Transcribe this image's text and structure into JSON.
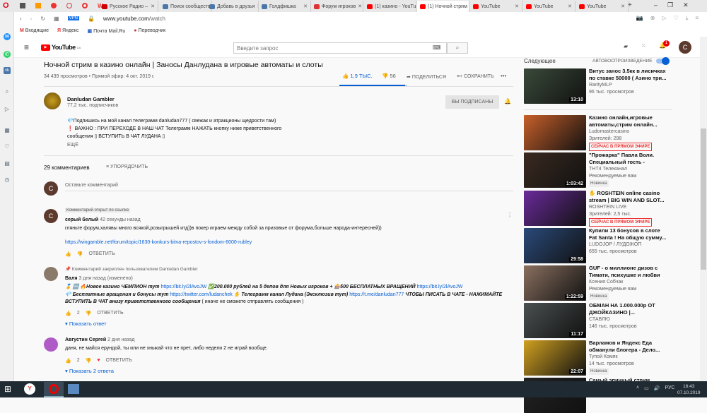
{
  "browser": {
    "tabs": [
      {
        "label": "Русское Радио –",
        "color": "#c00"
      },
      {
        "label": "Поиск сообществ",
        "color": "#4a76a8"
      },
      {
        "label": "Добавь в друзья",
        "color": "#4a76a8"
      },
      {
        "label": "Голдфишка",
        "color": "#4a76a8"
      },
      {
        "label": "Форум игроков",
        "color": "#d33"
      },
      {
        "label": "(1) казино - YouTube",
        "color": "#f00"
      },
      {
        "label": "(1) Ночной стрим",
        "color": "#f00"
      },
      {
        "label": "YouTube",
        "color": "#f00"
      },
      {
        "label": "YouTube",
        "color": "#f00"
      },
      {
        "label": "YouTube",
        "color": "#f00"
      }
    ],
    "url_domain": "www.youtube.com",
    "url_path": "/watch",
    "vpn": "VPN",
    "bookmarks": [
      "Входящие",
      "Яндекс",
      "Почта Mail.Ru",
      "Переводчик"
    ]
  },
  "youtube": {
    "logo": "YouTube",
    "region": "UA",
    "search_placeholder": "Введите запрос",
    "notif_count": "1",
    "user_initial": "C",
    "video": {
      "title": "Ночной стрим в казино онлайн | Заносы Данлудана в игровые автоматы и слоты",
      "meta": "34 439 просмотров • Прямой эфир: 4 окт. 2019 г.",
      "likes": "1,9 ТЫС.",
      "dislikes": "56",
      "share": "ПОДЕЛИТЬСЯ",
      "save": "СОХРАНИТЬ",
      "like_ratio": 0.97
    },
    "channel": {
      "name": "Danludan Gambler",
      "subs": "77,2 тыс. подписчиков",
      "subscribed": "ВЫ ПОДПИСАНЫ",
      "desc": [
        "💎Подпишись на мой канал телеграмм  danludan777  ( свежак и атракционы щедрости там)",
        "❗ ВАЖНО  : ПРИ ПЕРЕХОДЕ В НАШ ЧАТ Телеграмм НАЖАТЬ кнопку ниже приветственного",
        "сообщения  ▯ ВСТУПИТЬ В ЧАТ ЛУДАНА ▯"
      ],
      "more": "ЕЩЁ"
    },
    "comments_count": "29 комментариев",
    "sort": "УПОРЯДОЧИТЬ",
    "add_comment": "Оставьте комментарий",
    "reply": "ОТВЕТИТЬ",
    "comments": [
      {
        "badge": "Комментарий открыт по ссылке",
        "author": "серый белый",
        "time": "42 секунды назад",
        "text": "гляньте форум,халявы много всякой,розыгрышей итд))в покер играем между собой за призовые от форума,больше народа-интересней))",
        "link": "https://wingamble.net/forum/topic/1630-konkurs-bitva-repostov-s-fondom-6000-rubley",
        "initial": "С"
      },
      {
        "pinned": "Комментарий закреплен пользователем Danludan Gambler",
        "author": "Валя",
        "time": "3 дня назад (изменено)",
        "l1a": "🏅 🆓 🔥Новое казино ЧЕМПИОН тут",
        "l1b": "https://bit.ly/2lAvoJW",
        "l1c": "✅200.000 рублей на 5 депов для Новых игроков + 🎰500 БЕСПЛАТНЫХ ВРАЩЕНИЙ",
        "l1d": "https://bit.ly/2lAvoJW",
        "l2a": "💎 Бесплатные вращения и бонусы тут",
        "l2b": "https://twitter.com/ludanchek",
        "l2c": "✋ Телеграмм канал Лудана (Эксклюзив тут)",
        "l2d": "https://t.me/danludan777",
        "l2e": "ЧТОБЫ ПИСАТЬ В ЧАТЕ - НАЖИМАЙТЕ",
        "l3a": "ВСТУПИТЬ В ЧАТ внизу приветственного сообщения",
        "l3b": "( иначе не сможете отправлять сообщения )",
        "likes": "2",
        "replies": "Показать ответ"
      },
      {
        "author": "Августин Сергей",
        "time": "2 дня назад",
        "text": "даня, не майся ерундой, ты или не хныкай что не прет, либо недели 2 не играй вообще.",
        "likes": "2",
        "replies": "Показать 2 ответа"
      }
    ],
    "upnext": "Следующее",
    "autoplay": "АВТОВОСПРОИЗВЕДЕНИЕ",
    "autoplay_on": true,
    "related": [
      {
        "title": "Витус занос 3.5кк в лисичках по ставке 50000 ( Азино три...",
        "channel": "RarityMLP",
        "meta": "96 тыс. просмотров",
        "dur": "13:10",
        "bg": "#3a4a3a"
      },
      {
        "title": "Казино онлайн,игровые автоматы,стрим онлайн...",
        "channel": "Ludomastercasino",
        "meta": "Зрителей: 298",
        "live": "СЕЙЧАС В ПРЯМОМ ЭФИРЕ",
        "bg": "#c8602a"
      },
      {
        "title": "\"Прожарка\" Павла Воли. Специальный гость - Ляйсан...",
        "channel": "ТНТ4 Телеканал",
        "meta": "Рекомендуемые вам",
        "badge": "Новинка",
        "dur": "1:03:42",
        "bg": "#3a2a20"
      },
      {
        "title": "✋ ROSHTEIN online casino stream | BIG WIN AND SLOT...",
        "channel": "ROSHTEIN LIVE",
        "meta": "Зрителей: 2,5 тыс.",
        "live": "СЕЙЧАС В ПРЯМОМ ЭФИРЕ",
        "bg": "#6a2a9a"
      },
      {
        "title": "Купили 13 бонусов в слоте Fat Santa ! На общую сумму...",
        "channel": "LUDOJOP / ЛУДОЖОП",
        "meta": "655 тыс. просмотров",
        "dur": "29:58",
        "bg": "#2a4a7a"
      },
      {
        "title": "GUF - о миллионе дизов с Тимати, психушке и любви к...",
        "channel": "Ксения Собчак",
        "meta": "Рекомендуемые вам",
        "badge": "Новинка",
        "dur": "1:22:59",
        "bg": "#8a7060"
      },
      {
        "title": "ОБМАН НА 1.000.000р ОТ ДЖОЙКАЗИНО |...",
        "channel": "СТАВЛЮ",
        "meta": "146 тыс. просмотров",
        "dur": "11:17",
        "bg": "#4a5050"
      },
      {
        "title": "Варламов и Яндекс Еда обманули блогера - Дело...",
        "channel": "Тупой Комяк",
        "meta": "14 тыс. просмотров",
        "badge": "Новинка",
        "dur": "22:07",
        "bg": "#d0a020"
      },
      {
        "title": "Самый эпичный стрим Витуса",
        "channel": "",
        "meta": "",
        "bg": "#222"
      }
    ]
  },
  "taskbar": {
    "lang": "РУС",
    "time": "16:43",
    "date": "07.10.2019"
  }
}
